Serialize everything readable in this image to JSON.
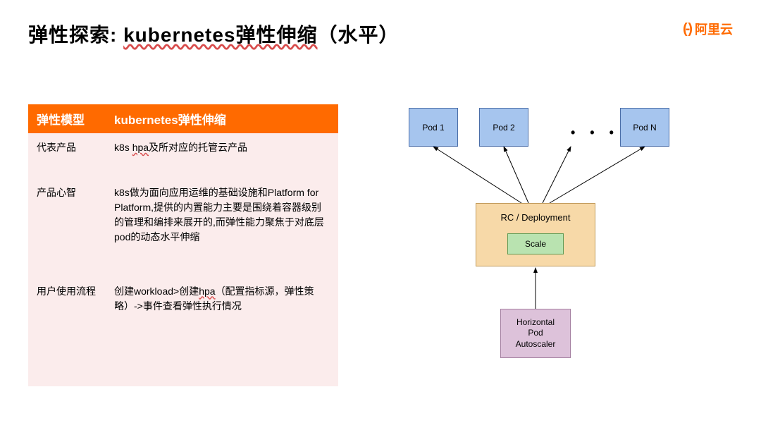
{
  "title": {
    "prefix": "弹性探索: ",
    "underlined": "kubernetes弹性伸缩",
    "suffix": "（水平）"
  },
  "logo": {
    "icon": "(-)",
    "text": "阿里云"
  },
  "table": {
    "header": {
      "col1": "弹性模型",
      "col2": "kubernetes弹性伸缩"
    },
    "rows": [
      {
        "label": "代表产品",
        "value_prefix": "k8s ",
        "value_under": "hpa",
        "value_suffix": "及所对应的托管云产品"
      },
      {
        "label": "产品心智",
        "value_prefix": "k8s做为面向应用运维的基础设施和Platform for Platform,提供的内置能力主要是围绕着容器级别的管理和编排来展开的,而弹性能力聚焦于对底层pod的动态水平伸缩",
        "value_under": "",
        "value_suffix": ""
      },
      {
        "label": "用户使用流程",
        "value_prefix": "创建workload>创建",
        "value_under": "hpa",
        "value_suffix": "（配置指标源，弹性策略）->事件查看弹性执行情况"
      }
    ]
  },
  "diagram": {
    "pod1": "Pod 1",
    "pod2": "Pod 2",
    "podN": "Pod N",
    "dots": "• • •",
    "rc": "RC / Deployment",
    "scale": "Scale",
    "hpa": "Horizontal\nPod\nAutoscaler"
  }
}
